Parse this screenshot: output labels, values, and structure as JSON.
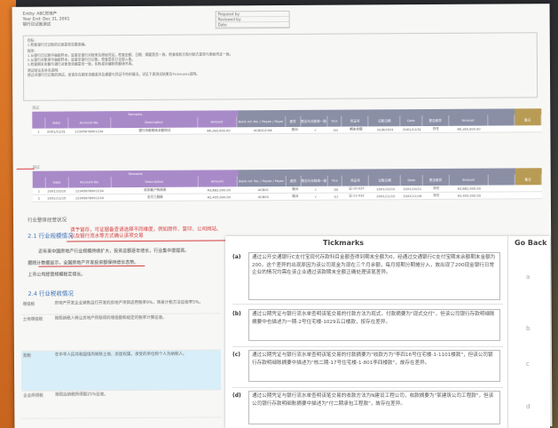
{
  "tickmarks": {
    "title": "Tickmarks",
    "go_back_label": "Go Back",
    "items": [
      {
        "mark": "(a)",
        "text": "通过公开交通银行C支付宝现代存款科目金额查得到期末全额为0，经通过交通银行C支付宝期末余额期末金额为200，这个差异的出现原因为该公司现金为现在三个月余额，每月按期分期摊分入，故出现了200现金银行日常企业的情况均需在该企业通过该款期末全额正确处理该笔差异。"
      },
      {
        "mark": "(b)",
        "text": "通过公期凭证与银行流水单查明该笔交易的付款方法为现式，付款摘要为\"现式交付\"，但该公司银行存款明细账摘要中也描述为一期-2号住宅楼-1029五口楼款，按存在差异。"
      },
      {
        "mark": "(c)",
        "text": "通过公期凭证与银行流水单查明该笔交易的付款摘要为\"收款方为\"李四16号住宅楼-1-1101楼款\"，但该公司银行存款明细账摘要中描述为\"核二期-17号住宅楼-1-801李四楼款\"，故存在差异。"
      },
      {
        "mark": "(d)",
        "text": "通过公期凭证与银行流水单查明该笔交易的收款方法为N建设工程公司，收款摘要为\"某建筑公司工程款\"，但该公司银行存款明细账摘要中描述为\"付二期承包工程款\"，故存在差异。"
      }
    ],
    "go_back_marks": [
      "a",
      "b",
      "c",
      "d"
    ]
  },
  "document": {
    "header_lines": [
      "Entity: ABC房地产",
      "Year End: Dec 31, 20X1",
      "银行日记账测试"
    ],
    "meta_rows": [
      "Prepared by:",
      "Reviewed by:",
      "Date:"
    ],
    "notes": [
      "目标:",
      "1.检查银行日记账的记录是否完整准确。",
      "程序:",
      "1.从银行日记账中抽取样本，追查至银行对账单及原始凭证，检查金额、日期、摘要是否一致，检查收款方和付款方是否与原始凭证一致。",
      "2.从银行对账单中抽取样本，追查至银行日记账，检查是否已全部入账。",
      "3.检查期末余额与银行对账单余额是否一致，如有差异编制余额调节表。",
      "测试结论及补充说明:",
      "经过对银行日记账的测试，发现存在期末余额差异及摘要与凭证不符的情况，详见下表测试结果及Tickmarks说明。"
    ],
    "table1_label": "测试",
    "table2_label": "测试",
    "table_band_label": "Remarks",
    "table_headers": [
      "Date",
      "Account No.",
      "Description",
      "Amount",
      "Bank ref. No. / Payee / Payer",
      "差异",
      "是否与对账单一致",
      "Tick",
      "凭证号",
      "记账日期",
      "Date",
      "是否差异",
      "Amount",
      "备注"
    ],
    "table1_rows": [
      [
        "1",
        "20X1/12/31",
        "12345678901234",
        "银行存款期末余额测试",
        "¥6,183,000.00",
        "ACB01/CHK",
        "核对",
        "√",
        "(a)",
        "期末余额",
        "GL/B/1001",
        "20X1/12/31",
        "存在",
        "¥6,183,000.00"
      ]
    ],
    "table2_rows": [
      [
        "1",
        "20X1/10/10",
        "12345678901234",
        "收到客户购房款",
        "¥3,682,000.00",
        "ACB02",
        "核对",
        "√",
        "(b)",
        "记-10-025",
        "20X1/10/10",
        "20X1/10/11",
        "存在",
        "¥3,682,000.00"
      ],
      [
        "2",
        "20X1/11/15",
        "12345678901234",
        "支付工程款",
        "¥2,405,000.00",
        "ACB03",
        "核对",
        "√",
        "(c)",
        "记-11-032",
        "20X1/11/15",
        "20X1/11/16",
        "存在",
        "¥2,405,000.00"
      ]
    ],
    "section_note": "行业整体经营状况",
    "section_21": "2.1 行业规模情况",
    "red_note_1": "请予留存，可证据备查请选择不同维度，例如原件、复印、公司网站、",
    "red_note_2": "以及银行流水等方式确认该项交易",
    "body_line_1": "近年来中国房地产行业规模持续扩大，投资总额逐年增长，行业集中度提高。",
    "body_line_2": "据统计数据显示，全国房地产开发投资额保持增长态势。",
    "body_line_3": "上市公司经营规模稳定增长。",
    "section_24": "2.4 行业税收情况",
    "left_rows": [
      {
        "key": "增值税",
        "value": "房地产开发企业销售自行开发的房地产项目适用税率9%，简易计税方法征收率5%。"
      },
      {
        "key": "土地增值税",
        "value": "按照纳税人转让房地产所取得的增值额和规定的税率计算征收。"
      },
      {
        "key": "契税",
        "value": "在中华人民共和国境内转移土地、房屋权属，承受的单位和个人为纳税人。"
      },
      {
        "key": "企业所得税",
        "value": "按照应纳税所得额25%征收。"
      }
    ]
  }
}
